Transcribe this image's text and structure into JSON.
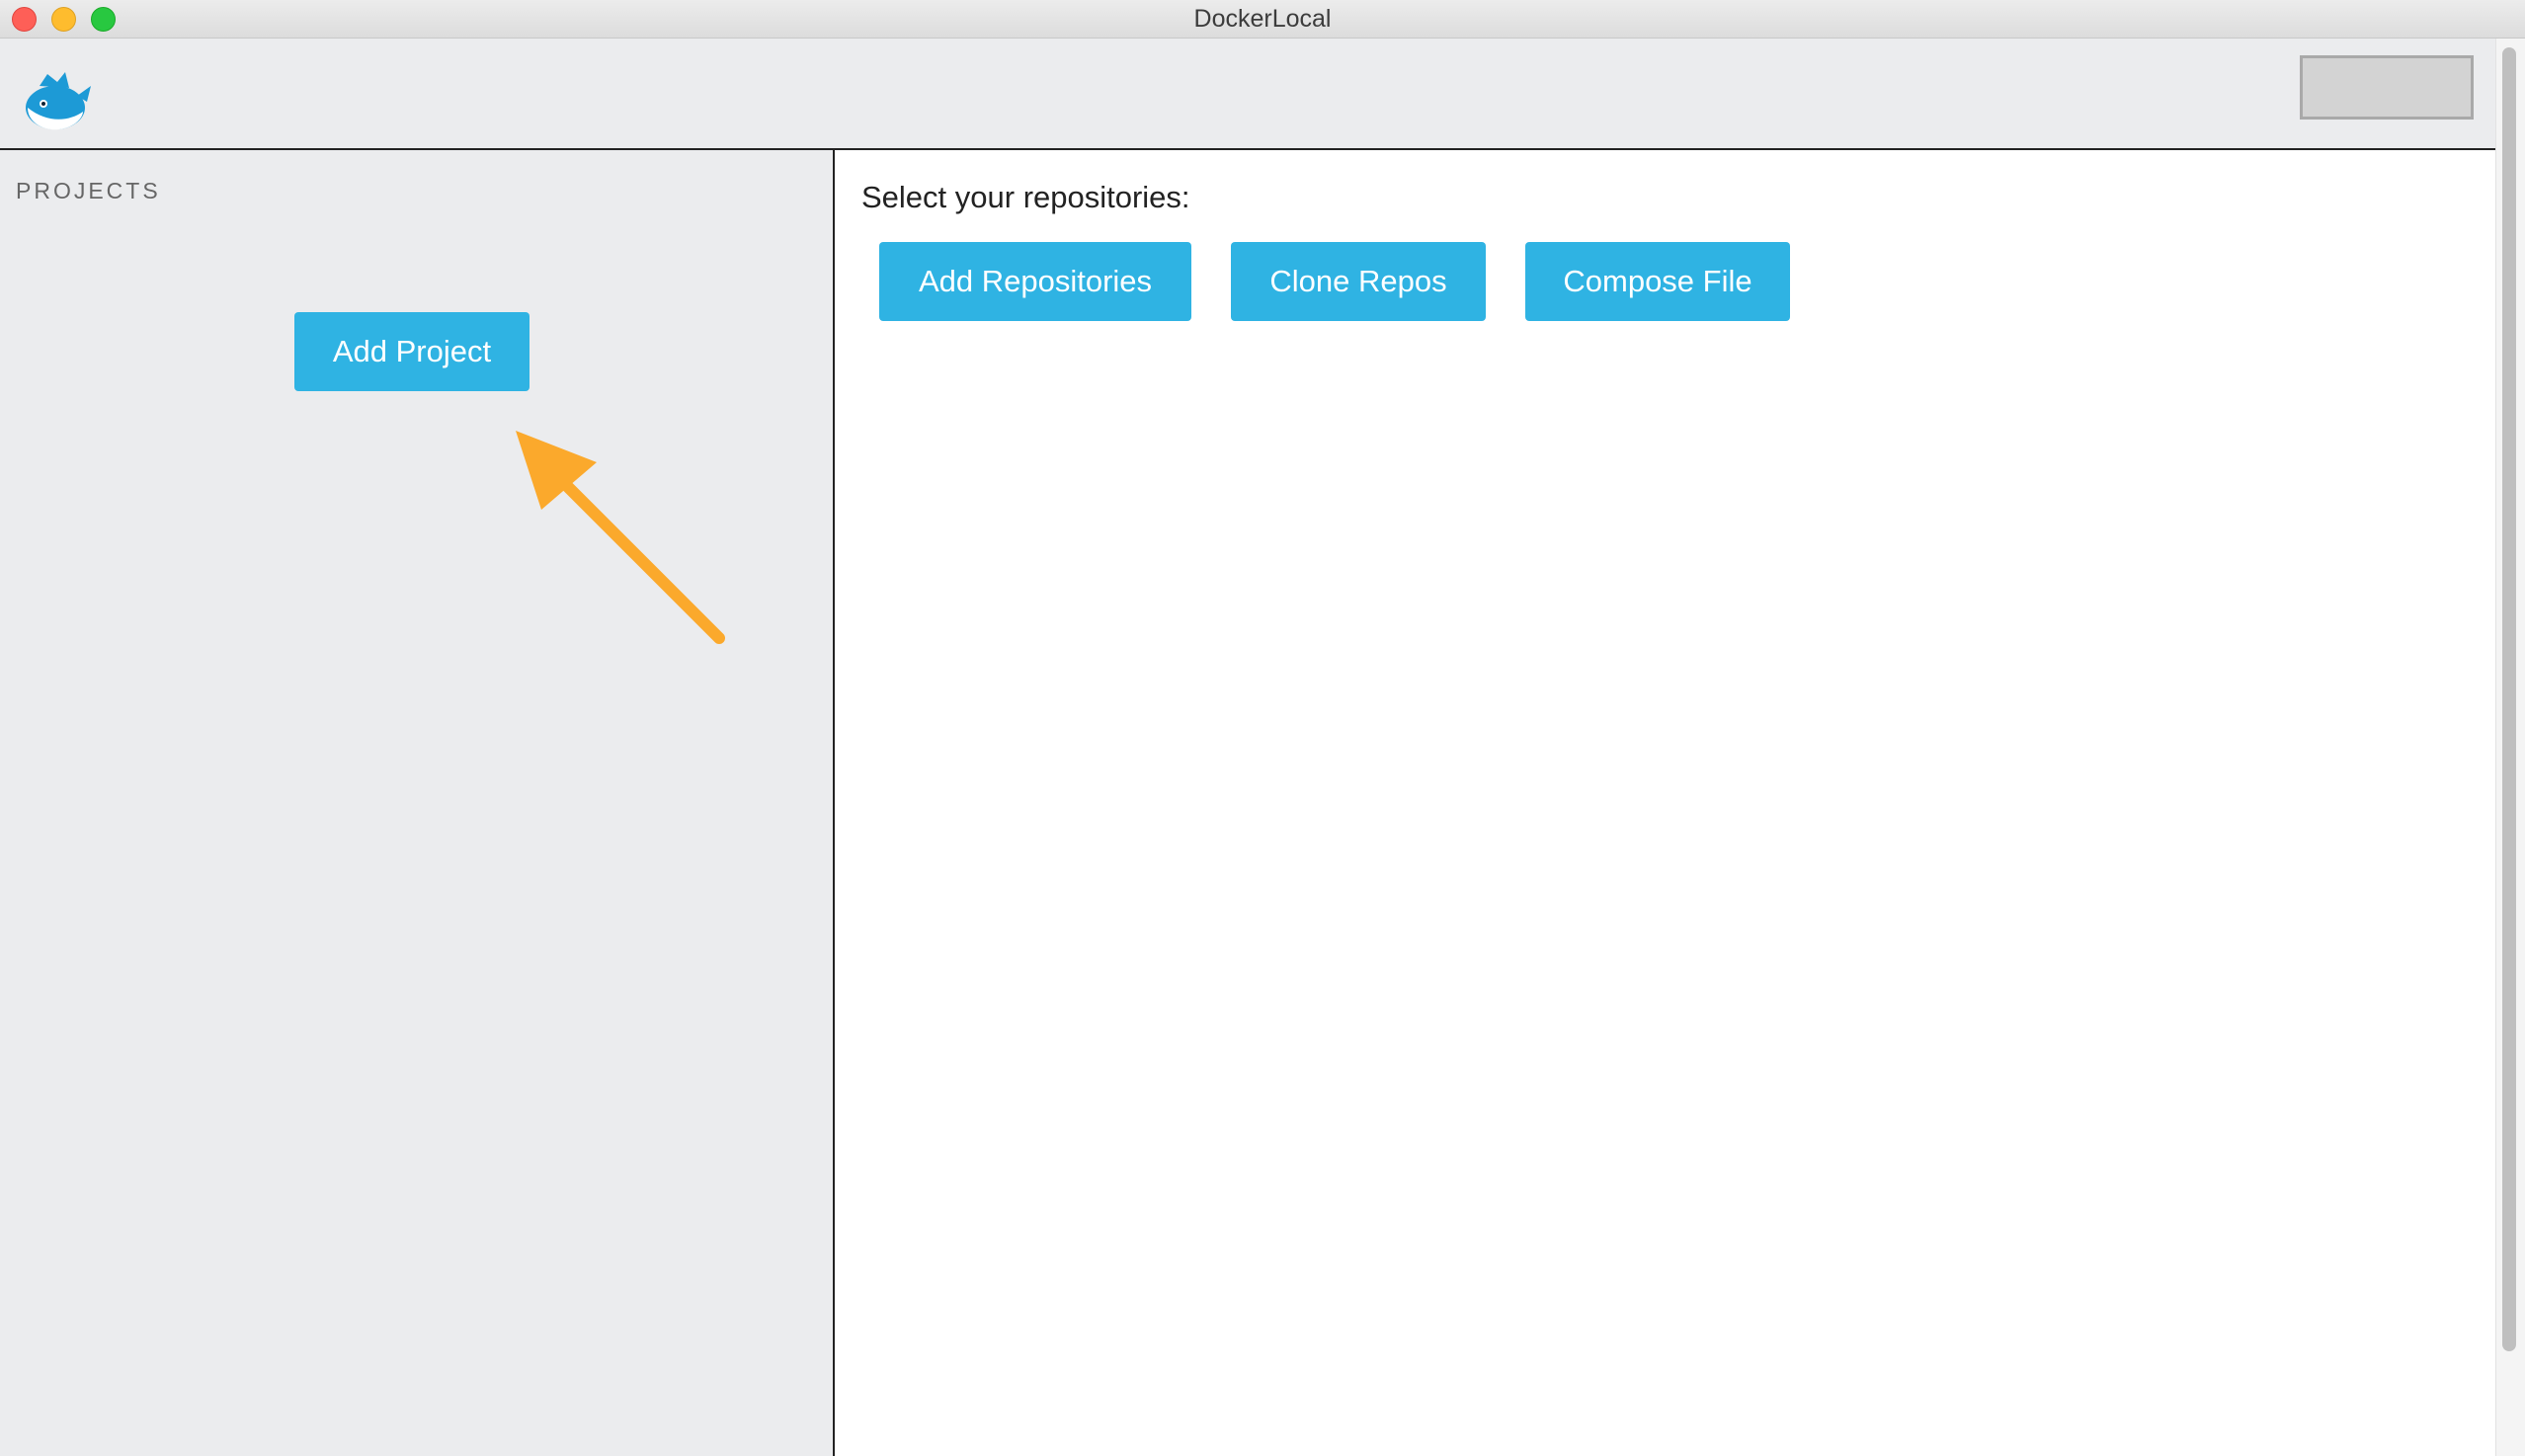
{
  "window": {
    "title": "DockerLocal",
    "controls": [
      "close",
      "minimize",
      "maximize"
    ]
  },
  "header": {
    "logo_icon": "docker-whale-icon",
    "action_button_label": ""
  },
  "sidebar": {
    "heading": "PROJECTS",
    "add_project_label": "Add Project"
  },
  "main": {
    "prompt": "Select your repositories:",
    "buttons": [
      {
        "label": "Add Repositories"
      },
      {
        "label": "Clone Repos"
      },
      {
        "label": "Compose File"
      }
    ]
  },
  "annotation": {
    "icon": "arrow-pointing-icon"
  },
  "colors": {
    "button_bg": "#2fb3e3",
    "button_text": "#ffffff",
    "panel_bg": "#ebecee",
    "annotation_arrow": "#fba92c"
  }
}
